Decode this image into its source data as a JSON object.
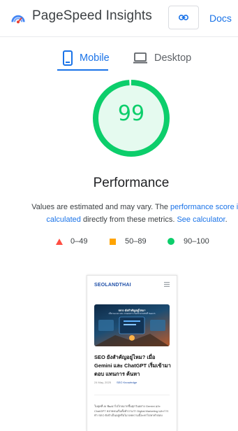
{
  "header": {
    "title": "PageSpeed Insights",
    "logo_icon": "pagespeed-logo-icon",
    "link_icon": "link-icon",
    "docs_label": "Docs"
  },
  "tabs": [
    {
      "label": "Mobile",
      "icon": "smartphone-icon",
      "active": true
    },
    {
      "label": "Desktop",
      "icon": "desktop-icon",
      "active": false
    }
  ],
  "score": {
    "value": "99",
    "fraction": 0.99,
    "category": "Performance",
    "color": "#0cce6b"
  },
  "note": {
    "prefix": "Values are estimated and may vary. The ",
    "link1": "performance score is calculated",
    "middle": " directly from these metrics. ",
    "link2": "See calculator",
    "suffix": "."
  },
  "legend": [
    {
      "range": "0–49",
      "shape": "triangle",
      "color": "#ff4e42"
    },
    {
      "range": "50–89",
      "shape": "square",
      "color": "#ffa400"
    },
    {
      "range": "90–100",
      "shape": "circle",
      "color": "#0cce6b"
    }
  ],
  "preview": {
    "brand": "SEOLANDTHAI",
    "hero_title": "SEO ยังสำคัญอยู่ไหม?",
    "hero_sub": "เมื่อ Gemini และ ChatGPT เริ่มเข้ามาแทนที่ Search",
    "article_title": "SEO ยังสำคัญอยู่ไหม? เมื่อ Gemini และ ChatGPT เริ่มเข้ามา ตอบ แทนการ ค้นหา",
    "date": "24 May, 2025",
    "category": "SEO Knowledge",
    "body": "ในยุคที่ AI พัฒนาไปไกลมากขึ้นทุกวันอย่าง Gemini และ ChatGPT หลายคนเริ่มตั้งคำถามว่า Digital Marketing และการทำ SEO ยังจำเป็นอยู่หรือไม่ บทความนี้จะพาไปหาคำตอบ"
  },
  "colors": {
    "accent": "#1a73e8",
    "pass": "#0cce6b",
    "average": "#ffa400",
    "fail": "#ff4e42"
  }
}
